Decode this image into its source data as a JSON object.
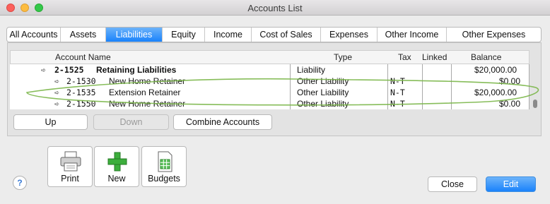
{
  "window": {
    "title": "Accounts List"
  },
  "tabs": [
    {
      "label": "All Accounts"
    },
    {
      "label": "Assets"
    },
    {
      "label": "Liabilities"
    },
    {
      "label": "Equity"
    },
    {
      "label": "Income"
    },
    {
      "label": "Cost of Sales"
    },
    {
      "label": "Expenses"
    },
    {
      "label": "Other Income"
    },
    {
      "label": "Other Expenses"
    }
  ],
  "active_tab": "Liabilities",
  "table": {
    "headers": {
      "account_name": "Account Name",
      "type": "Type",
      "tax": "Tax",
      "linked": "Linked",
      "balance": "Balance"
    },
    "rows": [
      {
        "number": "2-1525",
        "name": "Retaining Liabilities",
        "type": "Liability",
        "tax": "",
        "linked": "",
        "balance": "$20,000.00",
        "bold": true,
        "level": 0
      },
      {
        "number": "2-1530",
        "name": "New Home Retainer",
        "type": "Other Liability",
        "tax": "N-T",
        "linked": "",
        "balance": "$0.00",
        "bold": false,
        "level": 1
      },
      {
        "number": "2-1535",
        "name": "Extension Retainer",
        "type": "Other Liability",
        "tax": "N-T",
        "linked": "",
        "balance": "$20,000.00",
        "bold": false,
        "level": 1
      },
      {
        "number": "2-1550",
        "name": "New Home Retainer",
        "type": "Other Liability",
        "tax": "N-T",
        "linked": "",
        "balance": "$0.00",
        "bold": false,
        "level": 1
      }
    ]
  },
  "buttons": {
    "up": "Up",
    "down": "Down",
    "combine": "Combine Accounts",
    "print": "Print",
    "new": "New",
    "budgets": "Budgets",
    "close": "Close",
    "edit": "Edit",
    "help": "?"
  },
  "icons": {
    "row_arrow": "right-outline-arrow-icon",
    "print": "printer-icon",
    "new": "green-plus-icon",
    "budgets": "spreadsheet-icon"
  },
  "colors": {
    "accent": "#1a82fb",
    "highlight_ring": "#7ab648"
  }
}
